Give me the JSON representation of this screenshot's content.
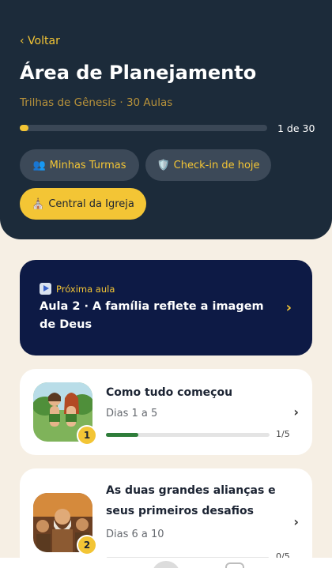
{
  "header": {
    "back_label": "‹ Voltar",
    "title": "Área de Planejamento",
    "subtitle": "Trilhas de Gênesis · 30 Aulas",
    "progress": {
      "current": 1,
      "total": 30,
      "label": "1 de 30"
    },
    "buttons": [
      {
        "icon": "👥",
        "label": "Minhas Turmas"
      },
      {
        "icon": "🛡️",
        "label": "Check-in de hoje"
      },
      {
        "icon": "⛪",
        "label": "Central da Igreja"
      }
    ]
  },
  "next_lesson": {
    "kicker": "Próxima aula",
    "title": "Aula 2 · A família reflete a imagem de Deus",
    "chevron": "›"
  },
  "lessons": [
    {
      "number": "1",
      "title": "Como tudo começou",
      "days": "Dias 1 a 5",
      "progress": 0.2,
      "count": "1/5",
      "chevron": "›"
    },
    {
      "number": "2",
      "title": "As duas grandes alianças e seus primeiros desafios",
      "days": "Dias 6 a 10",
      "progress": 0,
      "count": "0/5",
      "chevron": "›"
    }
  ],
  "colors": {
    "header_bg": "#1c2b3a",
    "accent": "#f3c535",
    "next_card_bg": "#0d1a45",
    "page_bg": "#f6efe4",
    "lesson_progress": "#2e7d3a"
  }
}
